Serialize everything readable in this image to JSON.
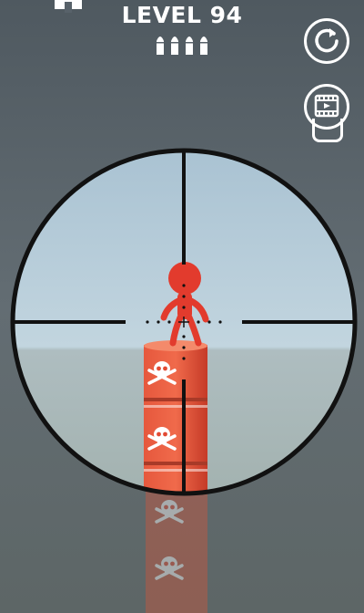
{
  "hud": {
    "level_label": "LEVEL 94",
    "bullets_remaining": 4
  },
  "icons": {
    "home": "home-icon",
    "restart": "restart-icon",
    "video": "video-ad-icon",
    "bullet": "bullet-icon",
    "skull": "skull-crossbones-icon"
  },
  "colors": {
    "background": "#58626a",
    "scope_view": "#b7cdd9",
    "scope_lower": "#a6b6ba",
    "stickman": "#e23b2d",
    "barrel": "#e24a33",
    "hud_text": "#ffffff",
    "crosshair": "#111111"
  }
}
